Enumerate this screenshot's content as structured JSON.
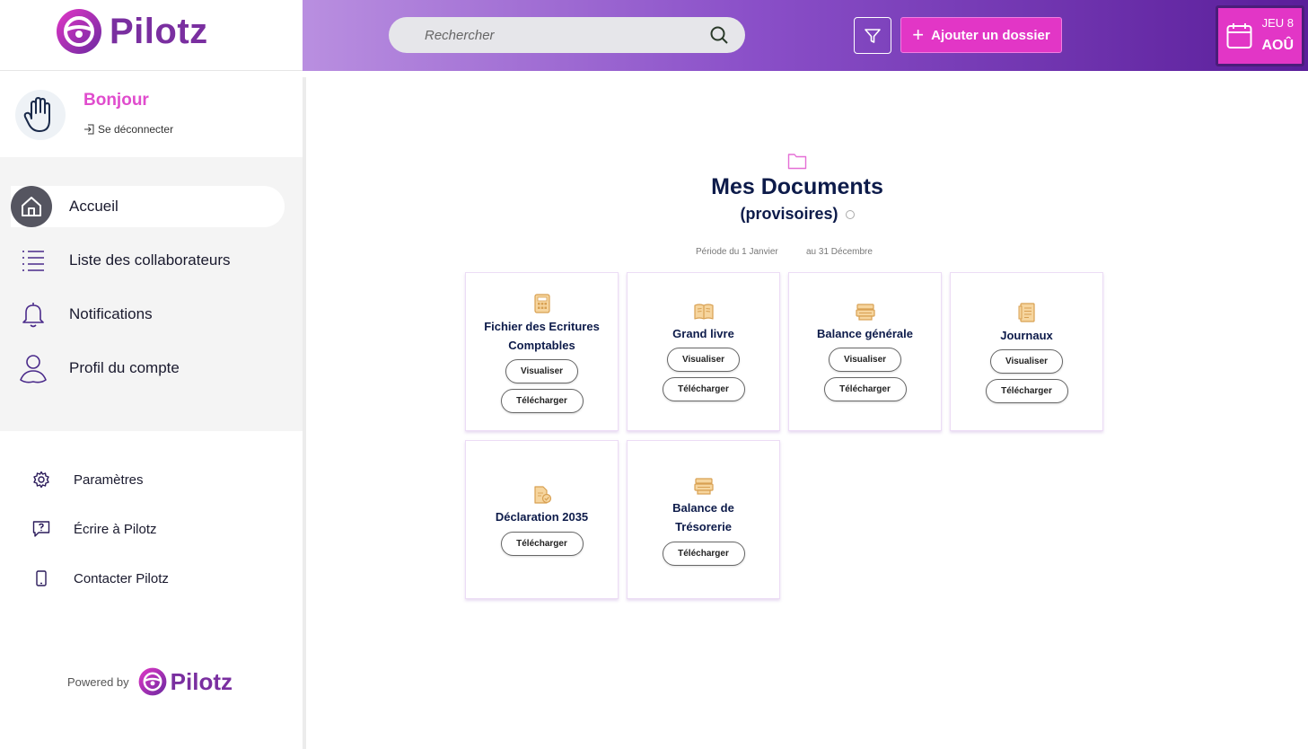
{
  "brand": {
    "name": "Pilotz",
    "accent": "#e236c6",
    "purple": "#7a2fa0"
  },
  "search": {
    "placeholder": "Rechercher"
  },
  "header": {
    "add_label": "Ajouter un dossier",
    "date_day": "JEU 8",
    "date_month": "AOÛ"
  },
  "user": {
    "greeting": "Bonjour",
    "logout": "Se déconnecter"
  },
  "nav": {
    "items": [
      {
        "label": "Accueil",
        "icon": "home-icon"
      },
      {
        "label": "Liste des collaborateurs",
        "icon": "list-icon"
      },
      {
        "label": "Notifications",
        "icon": "bell-icon"
      },
      {
        "label": "Profil du compte",
        "icon": "user-icon"
      }
    ]
  },
  "secondary": {
    "items": [
      {
        "label": "Paramètres",
        "icon": "gear-icon"
      },
      {
        "label": "Écrire à Pilotz",
        "icon": "help-chat-icon"
      },
      {
        "label": "Contacter Pilotz",
        "icon": "phone-icon"
      }
    ]
  },
  "footer": {
    "powered_by": "Powered by",
    "brand": "Pilotz"
  },
  "main": {
    "title": "Mes Documents",
    "subtitle": "(provisoires)",
    "period_from": "Période du 1 Janvier",
    "period_to": "au 31 Décembre",
    "view_label": "Visualiser",
    "download_label": "Télécharger",
    "cards": [
      {
        "name_1": "Fichier des Ecritures",
        "name_2": "Comptables",
        "icon": "calculator-icon"
      },
      {
        "name_1": "Grand livre",
        "icon": "book-icon"
      },
      {
        "name_1": "Balance générale",
        "icon": "cash-register-icon"
      },
      {
        "name_1": "Journaux",
        "icon": "journal-icon"
      },
      {
        "name_1": "Déclaration 2035",
        "icon": "document-check-icon"
      },
      {
        "name_1": "Balance de",
        "name_2": "Trésorerie",
        "icon": "cash-register-icon"
      }
    ]
  }
}
